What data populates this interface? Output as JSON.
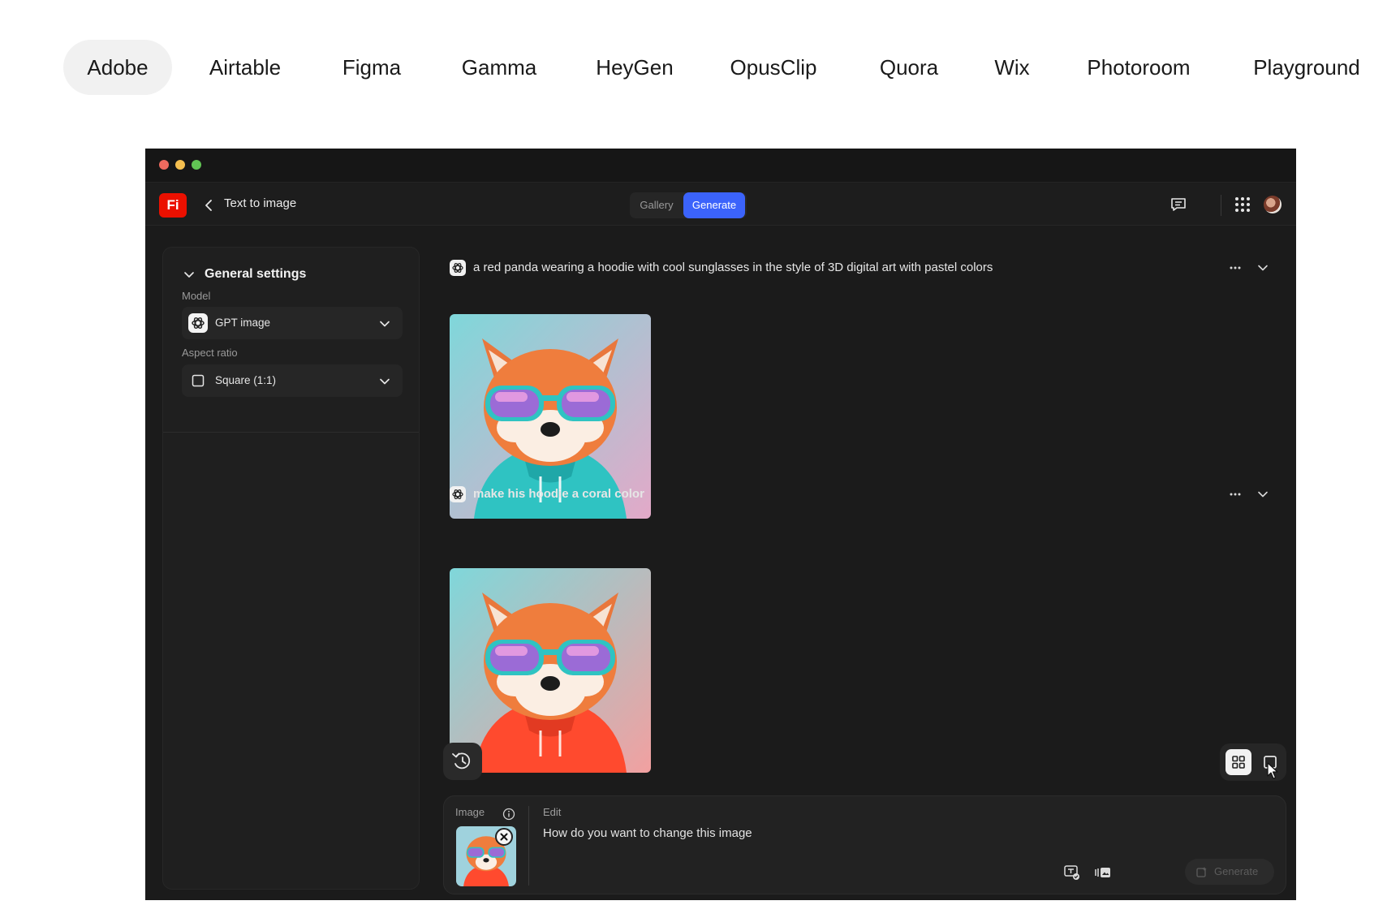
{
  "company_tabs": [
    {
      "label": "Adobe",
      "active": true
    },
    {
      "label": "Airtable",
      "active": false
    },
    {
      "label": "Figma",
      "active": false
    },
    {
      "label": "Gamma",
      "active": false
    },
    {
      "label": "HeyGen",
      "active": false
    },
    {
      "label": "OpusClip",
      "active": false
    },
    {
      "label": "Quora",
      "active": false
    },
    {
      "label": "Wix",
      "active": false
    },
    {
      "label": "Photoroom",
      "active": false
    },
    {
      "label": "Playground",
      "active": false
    }
  ],
  "app": {
    "logo_text": "Fi",
    "title": "Text to image",
    "view_switch": {
      "gallery_label": "Gallery",
      "generate_label": "Generate",
      "selected": "Generate"
    },
    "icons": [
      "back-chevron-icon",
      "comment-icon",
      "apps-grid-icon",
      "avatar"
    ],
    "colors": {
      "brand": "#eb1000",
      "accent": "#3b63fb",
      "background": "#1b1b1b",
      "panel": "#1f1f1f"
    }
  },
  "settings": {
    "section_title": "General settings",
    "model": {
      "label": "Model",
      "value": "GPT image",
      "icon": "openai-icon"
    },
    "aspect_ratio": {
      "label": "Aspect ratio",
      "value": "Square (1:1)",
      "icon": "square-icon"
    }
  },
  "generations": [
    {
      "prompt": "a red panda wearing a hoodie with cool sunglasses in the style of 3D digital art with pastel colors",
      "hoodie_color": "#2fc3c2",
      "background": [
        "#7fd7da",
        "#e3a9c8"
      ]
    },
    {
      "prompt": "make his hoodie a coral color",
      "hoodie_color": "#ff4a2e",
      "background": [
        "#7fd7da",
        "#f2a0a0"
      ]
    }
  ],
  "composer": {
    "image_label": "Image",
    "edit_label": "Edit",
    "placeholder": "How do you want to change this image",
    "generate_label": "Generate"
  },
  "view_toggle": {
    "options": [
      "grid-view-icon",
      "single-view-icon"
    ],
    "selected": "grid-view-icon"
  }
}
